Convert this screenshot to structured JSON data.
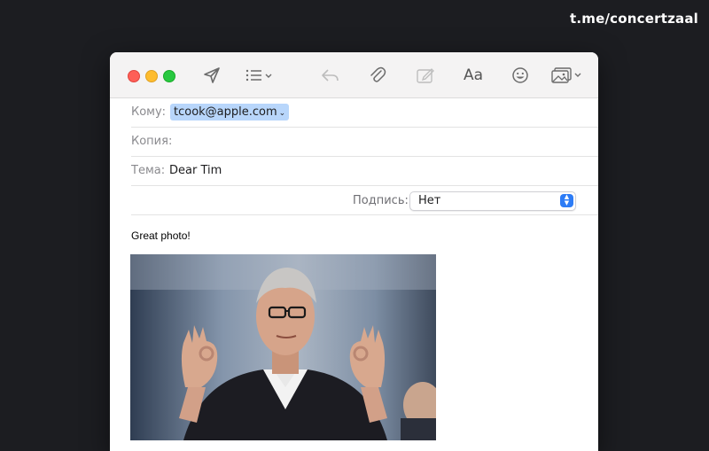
{
  "watermark": "t.me/concertzaal",
  "toolbar": {
    "buttons": [
      "send-icon",
      "list-icon",
      "reply-icon",
      "attachment-icon",
      "markup-icon",
      "font-icon",
      "emoji-icon",
      "photo-browser-icon"
    ],
    "font_label": "Aa"
  },
  "compose": {
    "to_label": "Кому:",
    "to_value": "tcook@apple.com",
    "cc_label": "Копия:",
    "subject_label": "Тема:",
    "subject_value": "Dear Tim",
    "signature_label": "Подпись:",
    "signature_value": "Нет"
  },
  "message": {
    "body": "Great photo!"
  },
  "colors": {
    "background": "#1c1d21",
    "recipient_chip": "#b8d6fb",
    "select_stepper": "#2d7cf6",
    "traffic_red": "#fe5f57",
    "traffic_yellow": "#febc2e",
    "traffic_green": "#28c840"
  }
}
